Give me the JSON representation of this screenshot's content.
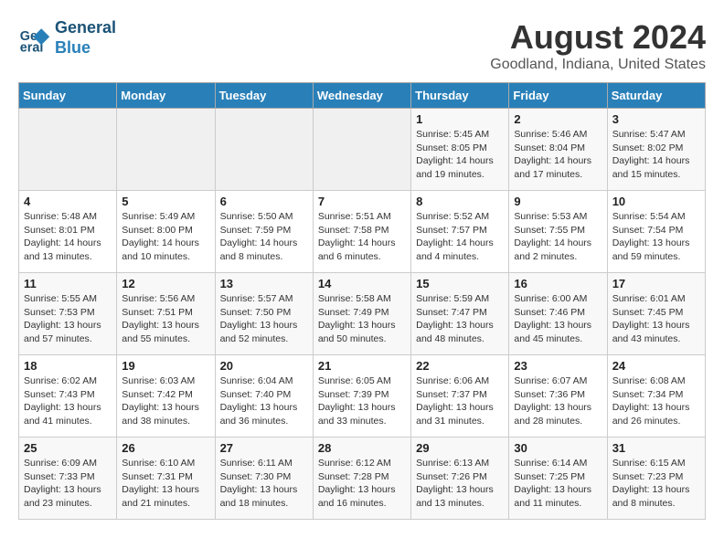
{
  "header": {
    "logo_line1": "General",
    "logo_line2": "Blue",
    "title": "August 2024",
    "subtitle": "Goodland, Indiana, United States"
  },
  "days_of_week": [
    "Sunday",
    "Monday",
    "Tuesday",
    "Wednesday",
    "Thursday",
    "Friday",
    "Saturday"
  ],
  "weeks": [
    [
      {
        "day": "",
        "info": ""
      },
      {
        "day": "",
        "info": ""
      },
      {
        "day": "",
        "info": ""
      },
      {
        "day": "",
        "info": ""
      },
      {
        "day": "1",
        "sunrise": "Sunrise: 5:45 AM",
        "sunset": "Sunset: 8:05 PM",
        "daylight": "Daylight: 14 hours and 19 minutes."
      },
      {
        "day": "2",
        "sunrise": "Sunrise: 5:46 AM",
        "sunset": "Sunset: 8:04 PM",
        "daylight": "Daylight: 14 hours and 17 minutes."
      },
      {
        "day": "3",
        "sunrise": "Sunrise: 5:47 AM",
        "sunset": "Sunset: 8:02 PM",
        "daylight": "Daylight: 14 hours and 15 minutes."
      }
    ],
    [
      {
        "day": "4",
        "sunrise": "Sunrise: 5:48 AM",
        "sunset": "Sunset: 8:01 PM",
        "daylight": "Daylight: 14 hours and 13 minutes."
      },
      {
        "day": "5",
        "sunrise": "Sunrise: 5:49 AM",
        "sunset": "Sunset: 8:00 PM",
        "daylight": "Daylight: 14 hours and 10 minutes."
      },
      {
        "day": "6",
        "sunrise": "Sunrise: 5:50 AM",
        "sunset": "Sunset: 7:59 PM",
        "daylight": "Daylight: 14 hours and 8 minutes."
      },
      {
        "day": "7",
        "sunrise": "Sunrise: 5:51 AM",
        "sunset": "Sunset: 7:58 PM",
        "daylight": "Daylight: 14 hours and 6 minutes."
      },
      {
        "day": "8",
        "sunrise": "Sunrise: 5:52 AM",
        "sunset": "Sunset: 7:57 PM",
        "daylight": "Daylight: 14 hours and 4 minutes."
      },
      {
        "day": "9",
        "sunrise": "Sunrise: 5:53 AM",
        "sunset": "Sunset: 7:55 PM",
        "daylight": "Daylight: 14 hours and 2 minutes."
      },
      {
        "day": "10",
        "sunrise": "Sunrise: 5:54 AM",
        "sunset": "Sunset: 7:54 PM",
        "daylight": "Daylight: 13 hours and 59 minutes."
      }
    ],
    [
      {
        "day": "11",
        "sunrise": "Sunrise: 5:55 AM",
        "sunset": "Sunset: 7:53 PM",
        "daylight": "Daylight: 13 hours and 57 minutes."
      },
      {
        "day": "12",
        "sunrise": "Sunrise: 5:56 AM",
        "sunset": "Sunset: 7:51 PM",
        "daylight": "Daylight: 13 hours and 55 minutes."
      },
      {
        "day": "13",
        "sunrise": "Sunrise: 5:57 AM",
        "sunset": "Sunset: 7:50 PM",
        "daylight": "Daylight: 13 hours and 52 minutes."
      },
      {
        "day": "14",
        "sunrise": "Sunrise: 5:58 AM",
        "sunset": "Sunset: 7:49 PM",
        "daylight": "Daylight: 13 hours and 50 minutes."
      },
      {
        "day": "15",
        "sunrise": "Sunrise: 5:59 AM",
        "sunset": "Sunset: 7:47 PM",
        "daylight": "Daylight: 13 hours and 48 minutes."
      },
      {
        "day": "16",
        "sunrise": "Sunrise: 6:00 AM",
        "sunset": "Sunset: 7:46 PM",
        "daylight": "Daylight: 13 hours and 45 minutes."
      },
      {
        "day": "17",
        "sunrise": "Sunrise: 6:01 AM",
        "sunset": "Sunset: 7:45 PM",
        "daylight": "Daylight: 13 hours and 43 minutes."
      }
    ],
    [
      {
        "day": "18",
        "sunrise": "Sunrise: 6:02 AM",
        "sunset": "Sunset: 7:43 PM",
        "daylight": "Daylight: 13 hours and 41 minutes."
      },
      {
        "day": "19",
        "sunrise": "Sunrise: 6:03 AM",
        "sunset": "Sunset: 7:42 PM",
        "daylight": "Daylight: 13 hours and 38 minutes."
      },
      {
        "day": "20",
        "sunrise": "Sunrise: 6:04 AM",
        "sunset": "Sunset: 7:40 PM",
        "daylight": "Daylight: 13 hours and 36 minutes."
      },
      {
        "day": "21",
        "sunrise": "Sunrise: 6:05 AM",
        "sunset": "Sunset: 7:39 PM",
        "daylight": "Daylight: 13 hours and 33 minutes."
      },
      {
        "day": "22",
        "sunrise": "Sunrise: 6:06 AM",
        "sunset": "Sunset: 7:37 PM",
        "daylight": "Daylight: 13 hours and 31 minutes."
      },
      {
        "day": "23",
        "sunrise": "Sunrise: 6:07 AM",
        "sunset": "Sunset: 7:36 PM",
        "daylight": "Daylight: 13 hours and 28 minutes."
      },
      {
        "day": "24",
        "sunrise": "Sunrise: 6:08 AM",
        "sunset": "Sunset: 7:34 PM",
        "daylight": "Daylight: 13 hours and 26 minutes."
      }
    ],
    [
      {
        "day": "25",
        "sunrise": "Sunrise: 6:09 AM",
        "sunset": "Sunset: 7:33 PM",
        "daylight": "Daylight: 13 hours and 23 minutes."
      },
      {
        "day": "26",
        "sunrise": "Sunrise: 6:10 AM",
        "sunset": "Sunset: 7:31 PM",
        "daylight": "Daylight: 13 hours and 21 minutes."
      },
      {
        "day": "27",
        "sunrise": "Sunrise: 6:11 AM",
        "sunset": "Sunset: 7:30 PM",
        "daylight": "Daylight: 13 hours and 18 minutes."
      },
      {
        "day": "28",
        "sunrise": "Sunrise: 6:12 AM",
        "sunset": "Sunset: 7:28 PM",
        "daylight": "Daylight: 13 hours and 16 minutes."
      },
      {
        "day": "29",
        "sunrise": "Sunrise: 6:13 AM",
        "sunset": "Sunset: 7:26 PM",
        "daylight": "Daylight: 13 hours and 13 minutes."
      },
      {
        "day": "30",
        "sunrise": "Sunrise: 6:14 AM",
        "sunset": "Sunset: 7:25 PM",
        "daylight": "Daylight: 13 hours and 11 minutes."
      },
      {
        "day": "31",
        "sunrise": "Sunrise: 6:15 AM",
        "sunset": "Sunset: 7:23 PM",
        "daylight": "Daylight: 13 hours and 8 minutes."
      }
    ]
  ]
}
